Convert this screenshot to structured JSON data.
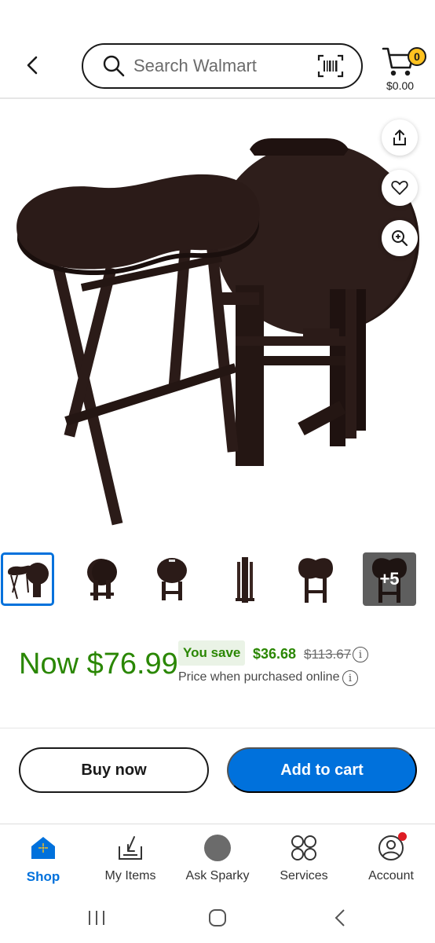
{
  "header": {
    "search_placeholder": "Search Walmart",
    "cart_count": "0",
    "cart_total": "$0.00"
  },
  "thumbnails": {
    "more_label": "+5",
    "count_visible": 6
  },
  "price": {
    "now": "Now $76.99",
    "you_save_label": "You save",
    "save_amount": "$36.68",
    "was_price": "$113.67",
    "note": "Price when purchased online",
    "info_glyph": "i"
  },
  "actions": {
    "buy_now": "Buy now",
    "add_to_cart": "Add to cart"
  },
  "bottom_nav": {
    "items": [
      {
        "label": "Shop",
        "icon": "shop-icon",
        "active": true
      },
      {
        "label": "My Items",
        "icon": "my-items-icon",
        "active": false
      },
      {
        "label": "Ask Sparky",
        "icon": "sparky-icon",
        "active": false
      },
      {
        "label": "Services",
        "icon": "services-icon",
        "active": false
      },
      {
        "label": "Account",
        "icon": "account-icon",
        "active": false
      }
    ]
  },
  "colors": {
    "brand_blue": "#0071dc",
    "price_green": "#2a8703",
    "badge_yellow": "#ffc220",
    "notification_red": "#de1c24"
  }
}
